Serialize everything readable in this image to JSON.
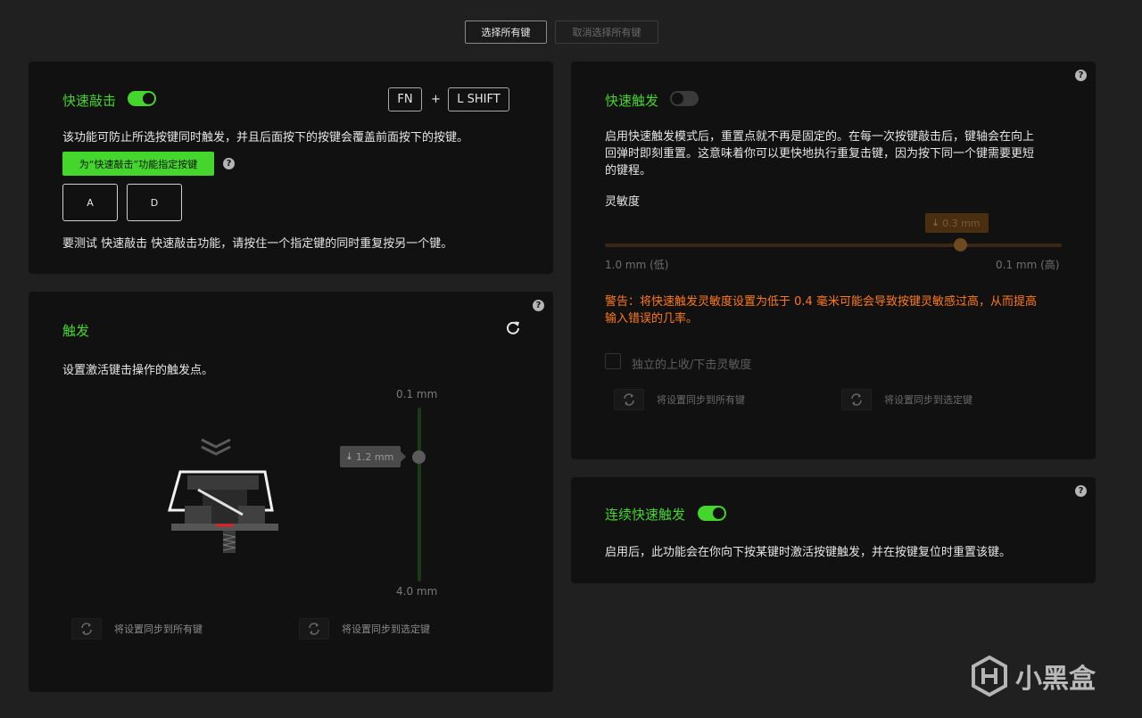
{
  "top": {
    "select_all": "选择所有键",
    "deselect_all": "取消选择所有键"
  },
  "snap_tap": {
    "title": "快速敲击",
    "enabled": true,
    "key1": "FN",
    "plus": "+",
    "key2": "L SHIFT",
    "description": "该功能可防止所选按键同时触发，并且后面按下的按键会覆盖前面按下的按键。",
    "assign_button": "为“快速敲击”功能指定按键",
    "help": "?",
    "keys": [
      "A",
      "D"
    ],
    "test_hint": "要测试 快速敲击 快速敲击功能，请按住一个指定键的同时重复按另一个键。"
  },
  "actuation": {
    "title": "触发",
    "help": "?",
    "reset_icon": "refresh-icon",
    "description": "设置激活键击操作的触发点。",
    "top_label": "0.1 mm",
    "bottom_label": "4.0 mm",
    "value_label": "1.2 mm",
    "value": 1.2,
    "min": 0.1,
    "max": 4.0,
    "sync_all": "将设置同步到所有键",
    "sync_selected": "将设置同步到选定键"
  },
  "rapid_trigger": {
    "title": "快速触发",
    "enabled": false,
    "help": "?",
    "description_line1": "启用快速触发模式后，重置点就不再是固定的。在每一次按键敲击后，键轴会在向上",
    "description_line2": "回弹时即刻重置。这意味着你可以更快地执行重复击键，因为按下同一个键需要更短",
    "description_line3": "的键程。",
    "sensitivity_label": "灵敏度",
    "slider_value_label": "0.3 mm",
    "slider_value": 0.3,
    "slider_min": "1.0 mm (低)",
    "slider_max": "0.1 mm (高)",
    "warning_line1": "警告：将快速触发灵敏度设置为低于 0.4 毫米可能会导致按键灵敏感过高，从而提高",
    "warning_line2": "输入错误的几率。",
    "independent_label": "独立的上收/下击灵敏度",
    "sync_all": "将设置同步到所有键",
    "sync_selected": "将设置同步到选定键"
  },
  "continuous": {
    "title": "连续快速触发",
    "enabled": true,
    "help": "?",
    "description": "启用后，此功能会在你向下按某键时激活按键触发，并在按键复位时重置该键。"
  },
  "watermark": {
    "text": "小黑盒"
  },
  "colors": {
    "accent": "#44d62c",
    "warning": "#ff7a1a",
    "panel": "#111111",
    "background": "#202020"
  }
}
